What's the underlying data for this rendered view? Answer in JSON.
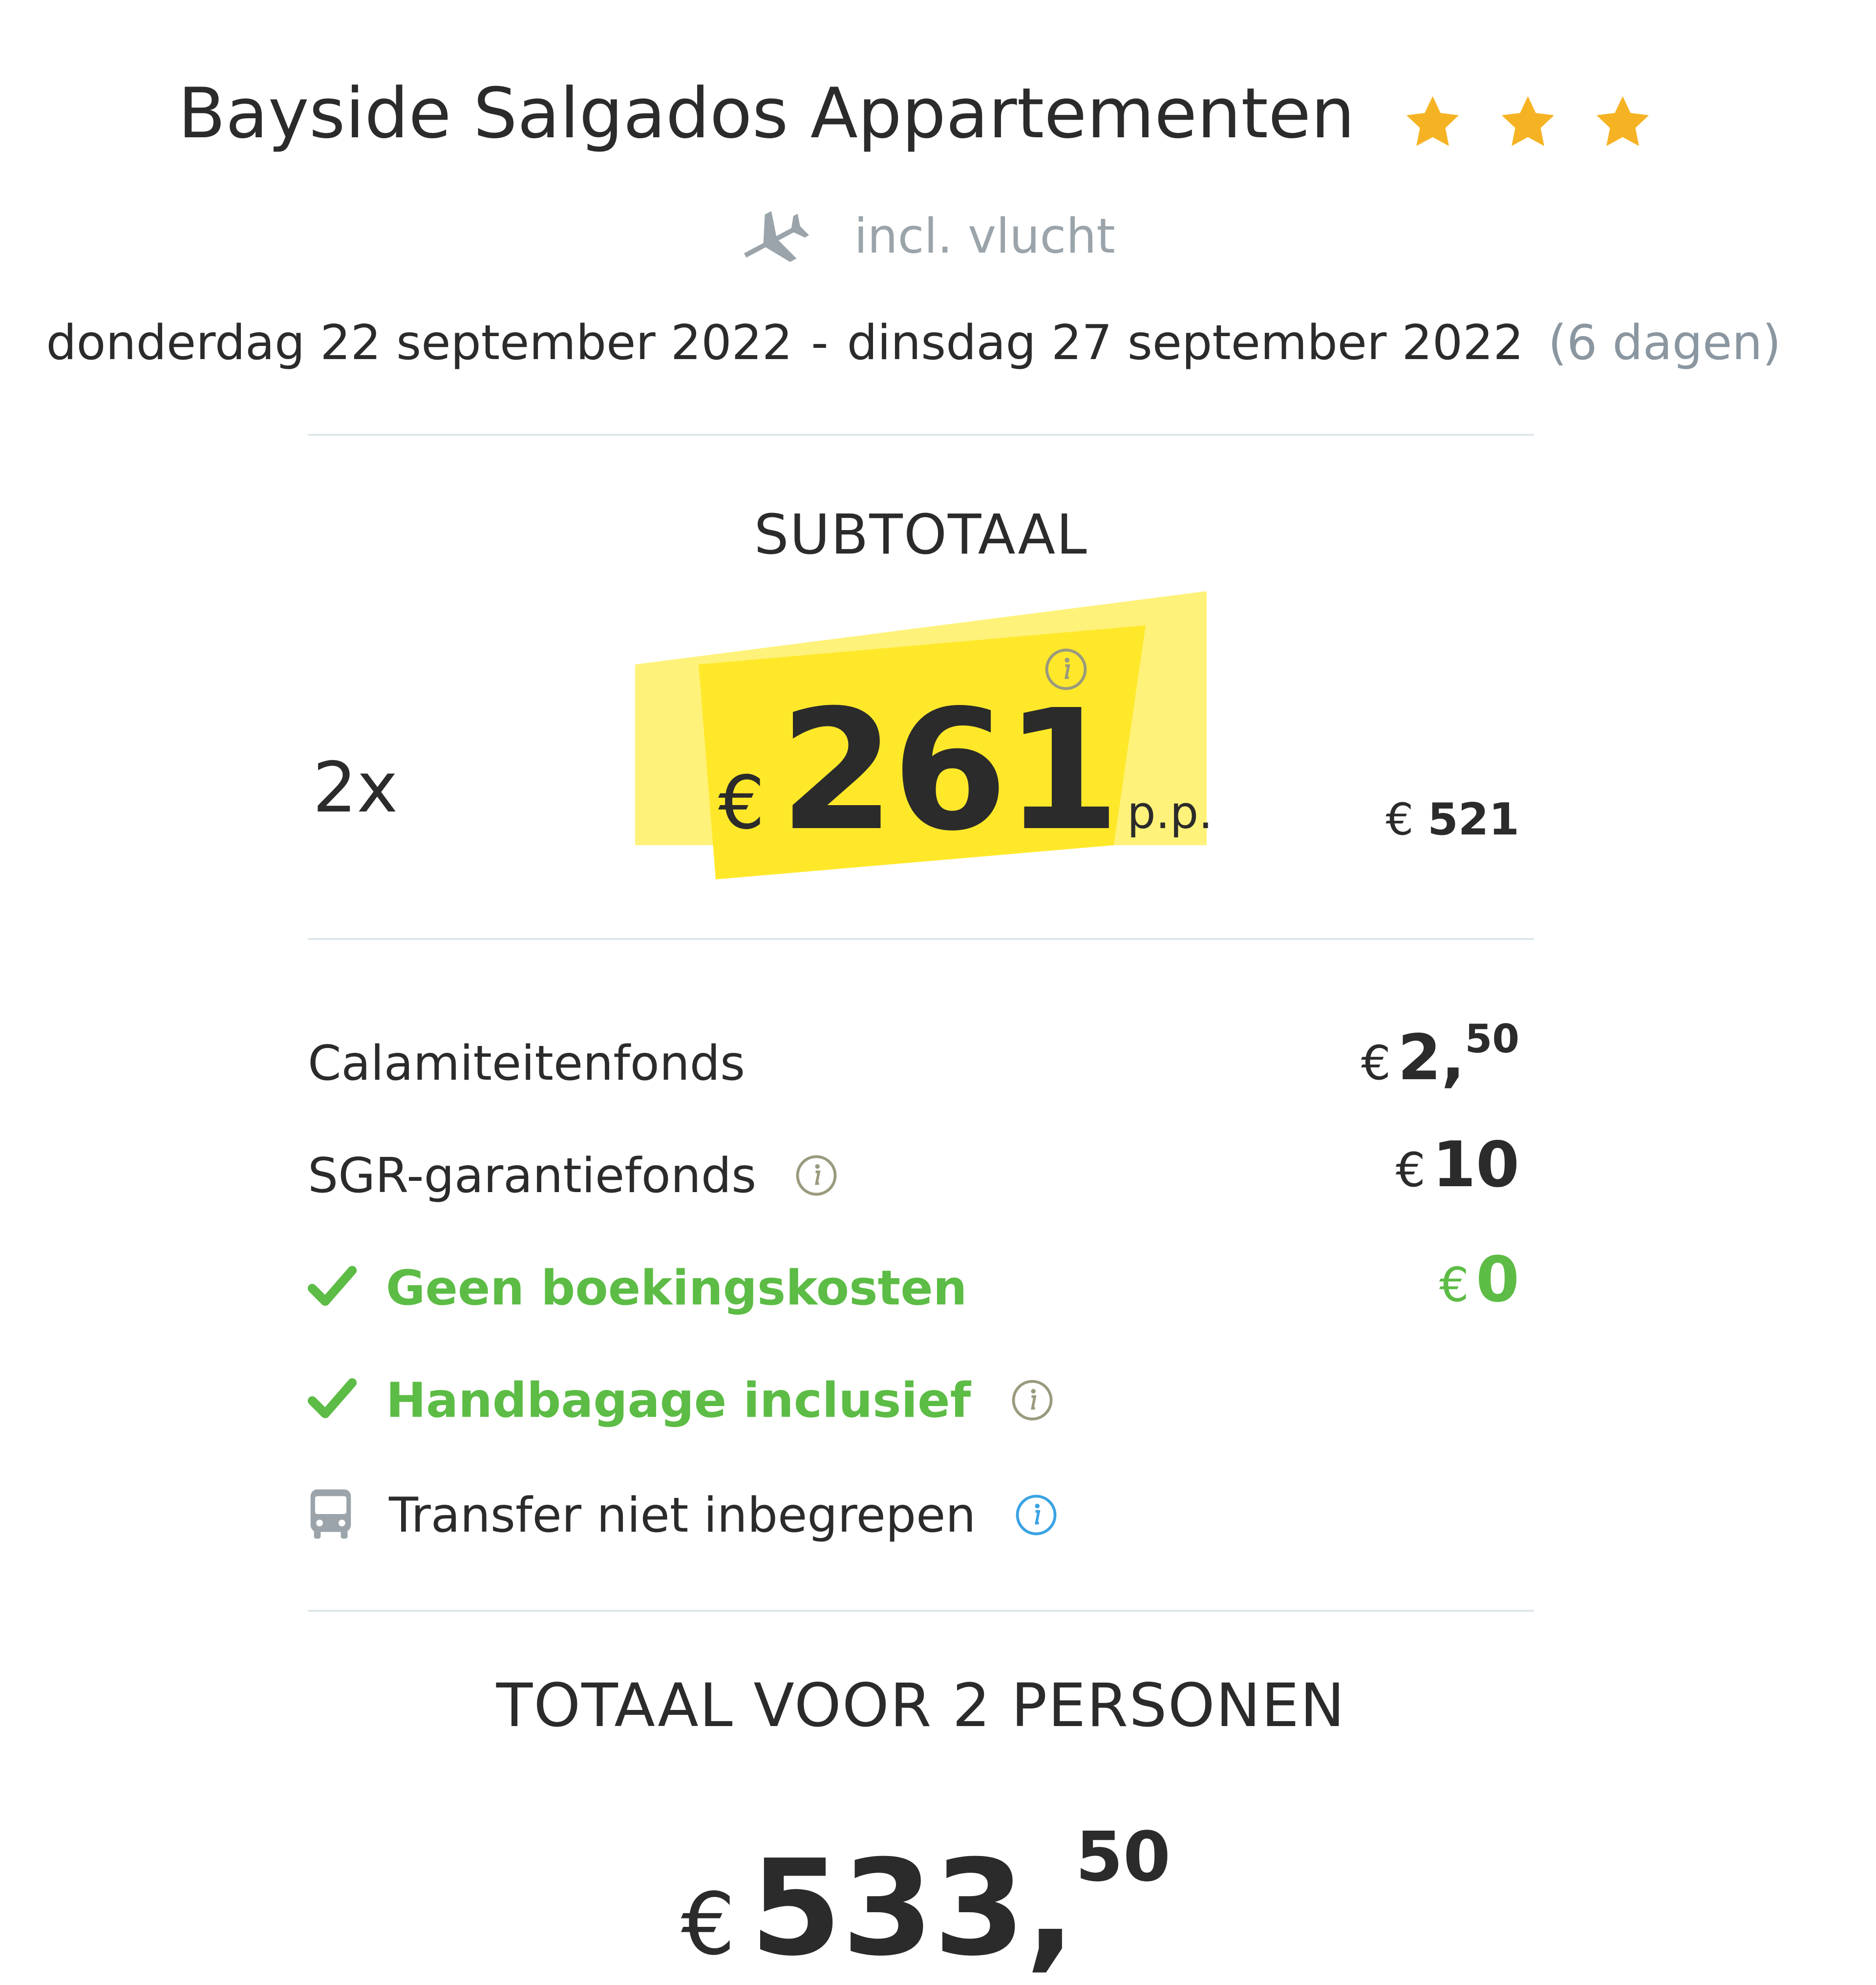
{
  "hotel": {
    "name": "Bayside Salgados Appartementen",
    "stars": 3,
    "star_color": "#f5b324"
  },
  "flight": {
    "icon": "plane-icon",
    "label": "incl. vlucht"
  },
  "dates": {
    "start": "donderdag 22 september 2022",
    "separator": "-",
    "end": "dinsdag 27 september 2022",
    "duration": "(6 dagen)"
  },
  "subtotal": {
    "title": "SUBTOTAAL",
    "quantity": "2x",
    "currency": "€",
    "price_pp": "261",
    "pp_label": "p.p.",
    "total_currency": "€",
    "total": "521",
    "highlight_color": "#ffe82a"
  },
  "costs": [
    {
      "label": "Calamiteitenfonds",
      "currency": "€",
      "amount": "2,",
      "cents": "50"
    },
    {
      "label": "SGR-garantiefonds",
      "currency": "€",
      "amount": "10",
      "cents": ""
    },
    {
      "label": "Geen boekingskosten",
      "currency": "€",
      "amount": "0",
      "cents": ""
    },
    {
      "label": "Handbagage inclusief"
    },
    {
      "label": "Transfer niet inbegrepen"
    }
  ],
  "grand_total": {
    "title": "TOTAAL VOOR 2 PERSONEN",
    "currency": "€",
    "amount": "533,",
    "cents": "50"
  },
  "colors": {
    "green": "#5cbc45",
    "info_blue": "#3aa3e3",
    "info_gray": "#9a9a7e",
    "muted": "#9aa4aa"
  }
}
